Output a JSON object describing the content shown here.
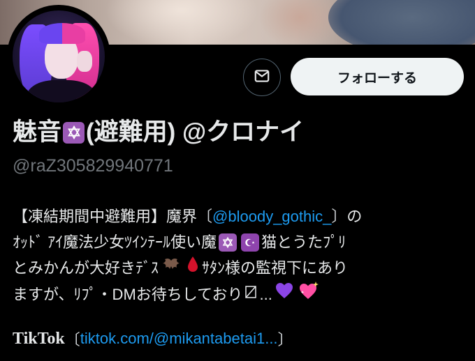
{
  "profile": {
    "name_main": "魅音",
    "name_rest": "(避難用) @クロナイ",
    "handle": "@raZ305829940771",
    "badge_icon": "star-of-david-icon",
    "badge_color": "#9b59b6"
  },
  "actions": {
    "follow_label": "フォローする",
    "message_icon": "envelope-icon"
  },
  "bio": {
    "line1_prefix": "【凍結期間中避難用】魔界",
    "line1_link": "@bloody_gothic_",
    "line1_suffix": "の",
    "line2_text": "ｵｯﾄﾞ ｱｲ魔法少女ﾂｲﾝﾃｰﾙ使い魔",
    "line2_suffix": "猫とうたﾌﾟﾘ",
    "line3_text": "とみかんが大好きﾃﾞｽ",
    "line3_suffix": "ｻﾀﾝ様の監視下にあり",
    "line4_text": "ますが、ﾘﾌﾟ・DMお待ちしており",
    "line4_ellipsis": "...",
    "tiktok_label": "TikTok",
    "tiktok_link": "tiktok.com/@mikantabetai1...",
    "bracket_open": "〔",
    "bracket_close": "〕"
  },
  "colors": {
    "link": "#1d9bf0",
    "background": "#000000",
    "text": "#e7e9ea",
    "muted": "#71767b",
    "follow_bg": "#eff3f4",
    "moon_badge": "#8e44ad",
    "heart_purple": "#8b45e6",
    "heart_pink": "#ff4fa3"
  }
}
